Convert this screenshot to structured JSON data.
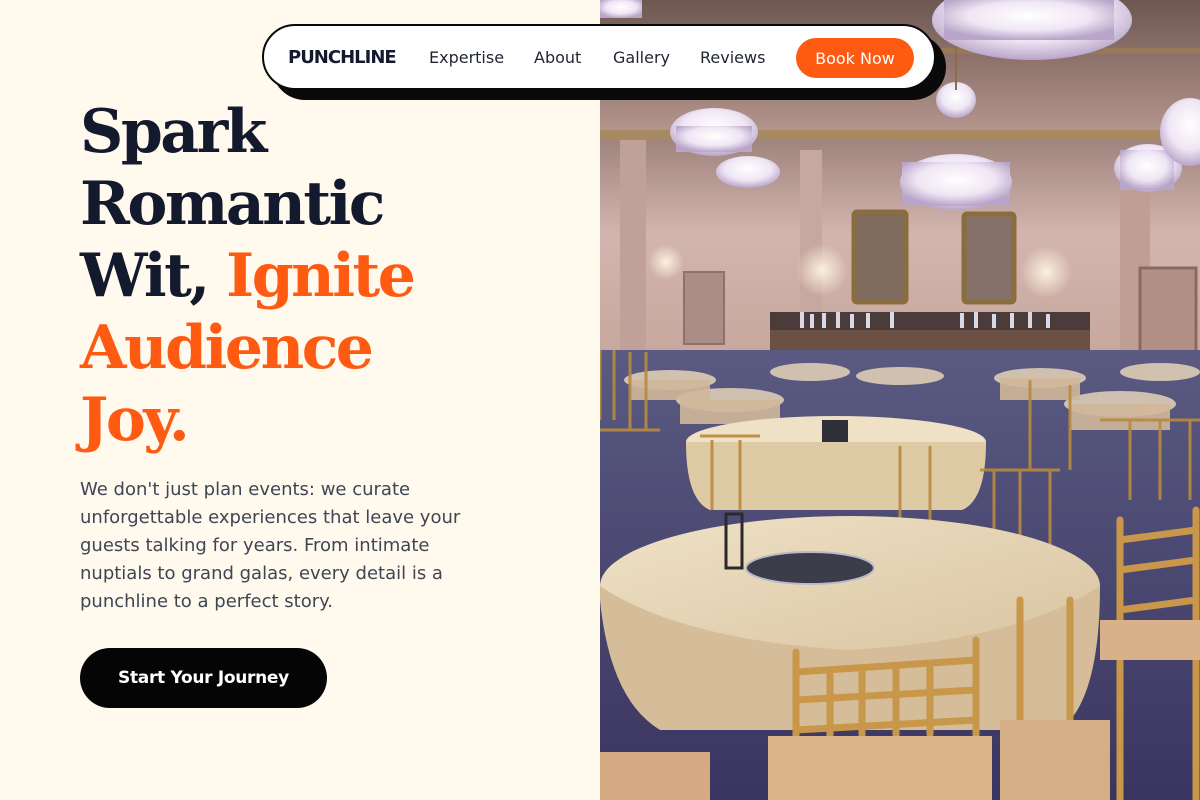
{
  "nav": {
    "logo": "PUNCHLINE",
    "links": [
      "Expertise",
      "About",
      "Gallery",
      "Reviews"
    ],
    "cta_label": "Book Now"
  },
  "hero": {
    "headline_lines": [
      {
        "text": "Spark",
        "highlight": false
      },
      {
        "text": "Romantic",
        "highlight": false
      },
      {
        "text_dark": "Wit, ",
        "text_accent": "Ignite"
      },
      {
        "text": "Audience",
        "highlight": true
      },
      {
        "text": "Joy.",
        "highlight": true
      }
    ],
    "description": "We don't just plan events: we curate unforgettable experiences that leave your guests talking for years. From intimate nuptials to grand galas, every detail is a punchline to a perfect story.",
    "cta_label": "Start Your Journey",
    "image": {
      "subject": "banquet ballroom with round tables, gold chiavari chairs and crystal chandeliers"
    }
  },
  "colors": {
    "background": "#fff9ee",
    "ink": "#131a2e",
    "accent": "#fe5a12",
    "body_text": "#3e4654",
    "button_dark": "#050505"
  }
}
